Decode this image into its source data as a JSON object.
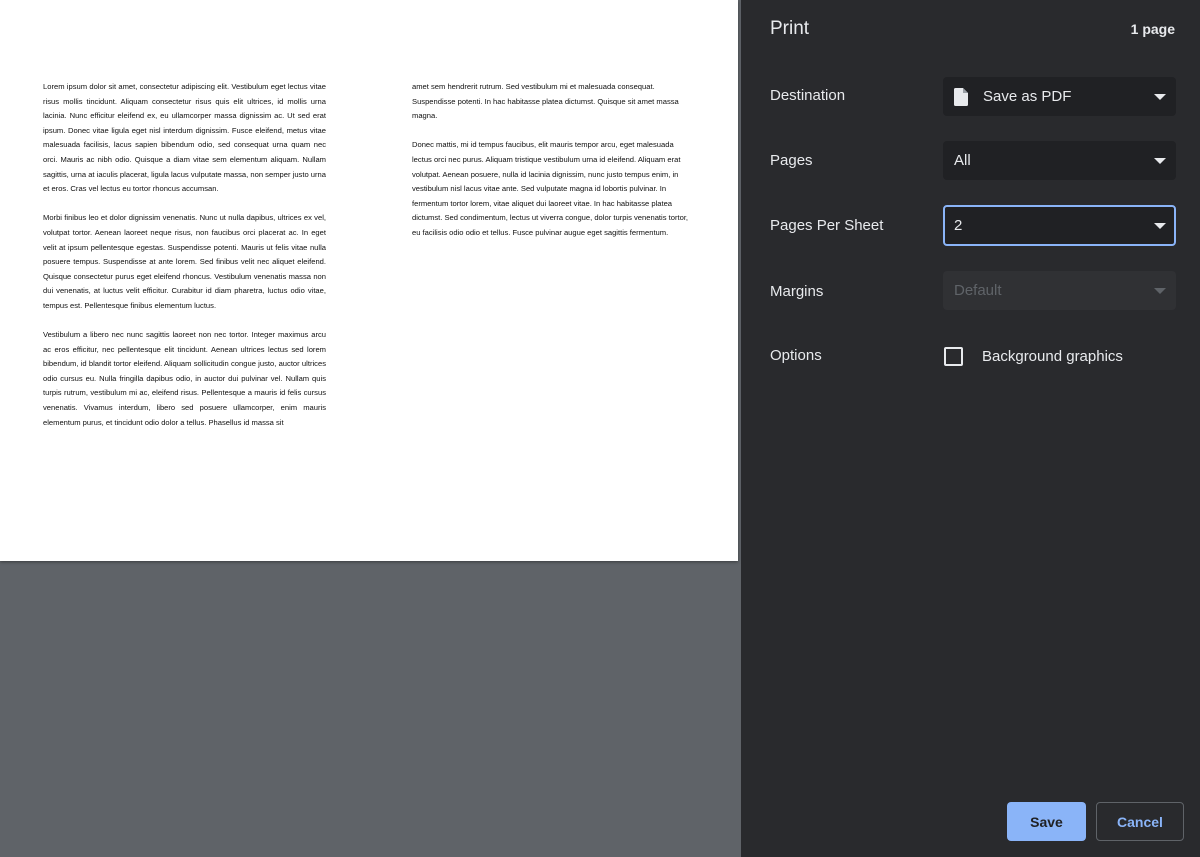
{
  "preview": {
    "left_column": [
      "Lorem ipsum dolor sit amet, consectetur adipiscing elit. Vestibulum eget lectus vitae risus mollis tincidunt. Aliquam consectetur risus quis elit ultrices, id mollis urna lacinia. Nunc efficitur eleifend ex, eu ullamcorper massa dignissim ac. Ut sed erat ipsum. Donec vitae ligula eget nisl interdum dignissim. Fusce eleifend, metus vitae malesuada facilisis, lacus sapien bibendum odio, sed consequat urna quam nec orci. Mauris ac nibh odio. Quisque a diam vitae sem elementum aliquam. Nullam sagittis, urna at iaculis placerat, ligula lacus vulputate massa, non semper justo urna et eros. Cras vel lectus eu tortor rhoncus accumsan.",
      "Morbi finibus leo et dolor dignissim venenatis. Nunc ut nulla dapibus, ultrices ex vel, volutpat tortor. Aenean laoreet neque risus, non faucibus orci placerat ac. In eget velit at ipsum pellentesque egestas. Suspendisse potenti. Mauris ut felis vitae nulla posuere tempus. Suspendisse at ante lorem. Sed finibus velit nec aliquet eleifend. Quisque consectetur purus eget eleifend rhoncus. Vestibulum venenatis massa non dui venenatis, at luctus velit efficitur. Curabitur id diam pharetra, luctus odio vitae, tempus est. Pellentesque finibus elementum luctus.",
      "Vestibulum a libero nec nunc sagittis laoreet non nec tortor. Integer maximus arcu ac eros efficitur, nec pellentesque elit tincidunt. Aenean ultrices lectus sed lorem bibendum, id blandit tortor eleifend. Aliquam sollicitudin congue justo, auctor ultrices odio cursus eu. Nulla fringilla dapibus odio, in auctor dui pulvinar vel. Nullam quis turpis rutrum, vestibulum mi ac, eleifend risus. Pellentesque a mauris id felis cursus venenatis. Vivamus interdum, libero sed posuere ullamcorper, enim mauris elementum purus, et tincidunt odio dolor a tellus. Phasellus id massa sit"
    ],
    "right_column": [
      "amet sem hendrerit rutrum. Sed vestibulum mi et malesuada consequat. Suspendisse potenti. In hac habitasse platea dictumst. Quisque sit amet massa magna.",
      "Donec mattis, mi id tempus faucibus, elit mauris tempor arcu, eget malesuada lectus orci nec purus. Aliquam tristique vestibulum urna id eleifend. Aliquam erat volutpat. Aenean posuere, nulla id lacinia dignissim, nunc justo tempus enim, in vestibulum nisl lacus vitae ante. Sed vulputate magna id lobortis pulvinar. In fermentum tortor lorem, vitae aliquet dui laoreet vitae. In hac habitasse platea dictumst. Sed condimentum, lectus ut viverra congue, dolor turpis venenatis tortor, eu facilisis odio odio et tellus. Fusce pulvinar augue eget sagittis fermentum."
    ]
  },
  "panel": {
    "title": "Print",
    "page_count": "1 page",
    "destination": {
      "label": "Destination",
      "value": "Save as PDF",
      "icon": "file-icon"
    },
    "pages": {
      "label": "Pages",
      "value": "All"
    },
    "pages_per_sheet": {
      "label": "Pages Per Sheet",
      "value": "2"
    },
    "margins": {
      "label": "Margins",
      "value": "Default",
      "disabled": true
    },
    "options": {
      "label": "Options",
      "background_graphics": {
        "label": "Background graphics",
        "checked": false
      }
    },
    "buttons": {
      "save": "Save",
      "cancel": "Cancel"
    }
  },
  "colors": {
    "panel_bg": "#292a2d",
    "preview_bg": "#5f6368",
    "accent": "#8ab4f8",
    "text": "#e8eaed",
    "select_bg": "#202124"
  }
}
